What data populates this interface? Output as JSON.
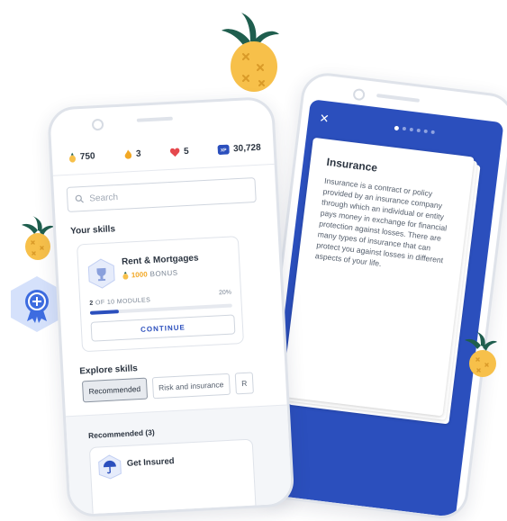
{
  "stats": {
    "coins": "750",
    "streak": "3",
    "hearts": "5",
    "xp": "30,728"
  },
  "search": {
    "placeholder": "Search"
  },
  "skills_heading": "Your skills",
  "skill_card": {
    "title": "Rent & Mortgages",
    "bonus_amount": "1000",
    "bonus_label": "BONUS",
    "modules_done": "2",
    "modules_text": "OF 10 MODULES",
    "percent_label": "20%",
    "progress": 0.2,
    "continue_label": "CONTINUE"
  },
  "explore_heading": "Explore skills",
  "chips": [
    "Recommended",
    "Risk and insurance",
    "R"
  ],
  "recommended_heading": "Recommended (3)",
  "recommended_item_title": "Get Insured",
  "lesson": {
    "title": "Insurance",
    "body": "Insurance is a contract or policy provided by an insurance company through which an individual or entity pays money in exchange for financial protection against losses. There are many types of insurance that can protect you against losses in different aspects of your life."
  },
  "colors": {
    "brand_blue": "#2b4fbd",
    "gold": "#f2a825",
    "pineapple": "#f7c04a",
    "leaf": "#1f5e4e"
  }
}
